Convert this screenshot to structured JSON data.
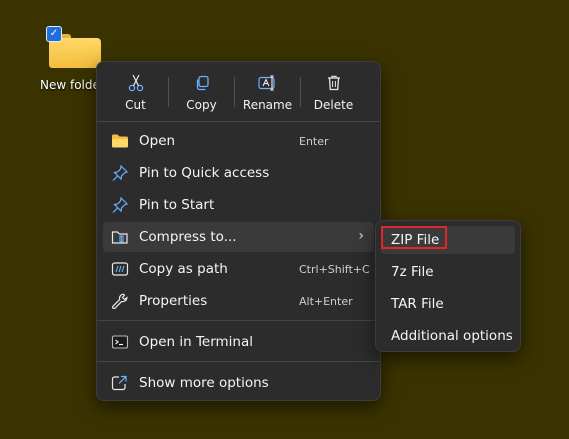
{
  "desktop": {
    "folder_label": "New folder",
    "checkbox_glyph": "✓"
  },
  "quick_actions": [
    {
      "label": "Cut",
      "icon": "scissors-icon"
    },
    {
      "label": "Copy",
      "icon": "copy-icon"
    },
    {
      "label": "Rename",
      "icon": "rename-icon"
    },
    {
      "label": "Delete",
      "icon": "trash-icon"
    }
  ],
  "menu": {
    "open": {
      "label": "Open",
      "shortcut": "Enter",
      "icon": "folder-icon"
    },
    "pin_quick": {
      "label": "Pin to Quick access",
      "icon": "pin-icon"
    },
    "pin_start": {
      "label": "Pin to Start",
      "icon": "pin-icon"
    },
    "compress": {
      "label": "Compress to...",
      "chevron": "›",
      "icon": "archive-icon"
    },
    "copy_path": {
      "label": "Copy as path",
      "shortcut": "Ctrl+Shift+C",
      "icon": "path-icon"
    },
    "properties": {
      "label": "Properties",
      "shortcut": "Alt+Enter",
      "icon": "wrench-icon"
    },
    "terminal": {
      "label": "Open in Terminal",
      "icon": "terminal-icon"
    },
    "more": {
      "label": "Show more options",
      "icon": "share-icon"
    }
  },
  "submenu": {
    "items": [
      "ZIP File",
      "7z File",
      "TAR File",
      "Additional options"
    ]
  },
  "colors": {
    "desktop_bg": "#3a3300",
    "menu_bg": "#2c2c2c",
    "accent_blue": "#4aa3ff",
    "highlight_red": "#e0262a"
  }
}
